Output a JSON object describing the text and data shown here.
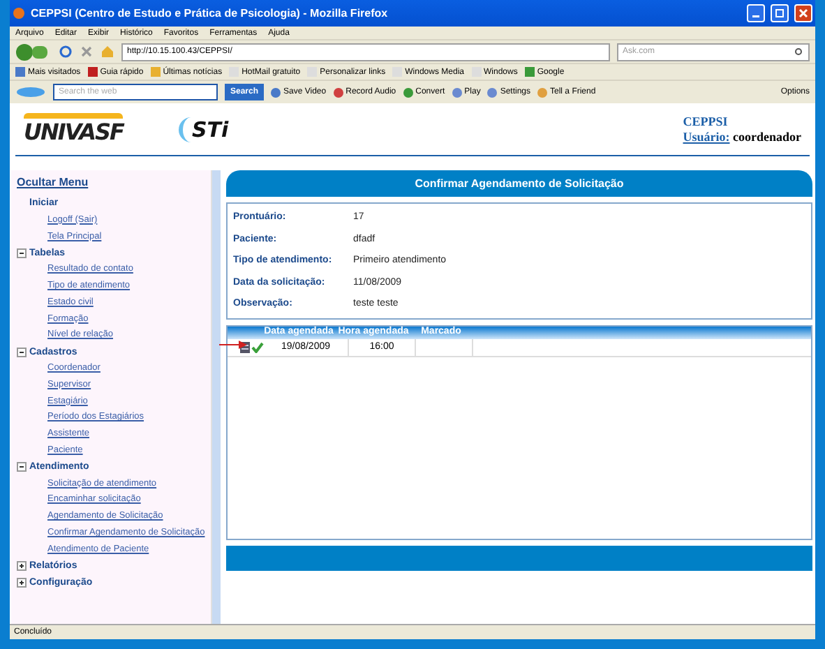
{
  "window": {
    "title": "CEPPSI (Centro de Estudo e Prática de Psicologia) - Mozilla Firefox"
  },
  "menu_bar": [
    "Arquivo",
    "Editar",
    "Exibir",
    "Histórico",
    "Favoritos",
    "Ferramentas",
    "Ajuda"
  ],
  "navigation": {
    "url": "http://10.15.100.43/CEPPSI/",
    "search_placeholder": "Ask.com"
  },
  "bookmarks": [
    "Mais visitados",
    "Guia rápido",
    "Últimas notícias",
    "HotMail gratuito",
    "Personalizar links",
    "Windows Media",
    "Windows",
    "Google"
  ],
  "ask_toolbar": {
    "search_placeholder": "Search the web",
    "search_button": "Search",
    "items": [
      "Save Video",
      "Record Audio",
      "Convert",
      "Play",
      "Settings",
      "Tell a Friend"
    ],
    "options": "Options"
  },
  "header": {
    "logos": [
      "UNIVASF",
      "STi"
    ],
    "system": "CEPPSI",
    "user_label": "Usuário:",
    "user": "coordenador"
  },
  "sidebar": {
    "toggle": "Ocultar Menu",
    "groups": [
      {
        "label": "Iniciar",
        "children": [
          "Logoff (Sair)",
          "Tela Principal"
        ]
      },
      {
        "label": "Tabelas",
        "expanded": true,
        "children": [
          "Resultado de contato",
          "Tipo de atendimento",
          "Estado civil",
          "Formação",
          "Nível de relação"
        ]
      },
      {
        "label": "Cadastros",
        "expanded": true,
        "children": [
          "Coordenador",
          "Supervisor",
          "Estagiário",
          "Período dos Estagiários",
          "Assistente",
          "Paciente"
        ]
      },
      {
        "label": "Atendimento",
        "expanded": true,
        "children": [
          "Solicitação de atendimento",
          "Encaminhar solicitação",
          "Agendamento de Solicitação",
          "Confirmar Agendamento de Solicitação",
          "Atendimento de Paciente"
        ]
      },
      {
        "label": "Relatórios",
        "expanded": false
      },
      {
        "label": "Configuração",
        "expanded": false
      }
    ]
  },
  "panel": {
    "title": "Confirmar Agendamento de Solicitação",
    "fields": [
      {
        "label": "Prontuário:",
        "value": "17"
      },
      {
        "label": "Paciente:",
        "value": "dfadf"
      },
      {
        "label": "Tipo de atendimento:",
        "value": "Primeiro atendimento"
      },
      {
        "label": "Data da solicitação:",
        "value": "11/08/2009"
      },
      {
        "label": "Observação:",
        "value": "teste teste"
      }
    ],
    "table": {
      "columns": [
        "Data agendada",
        "Hora agendada",
        "Marcado"
      ],
      "rows": [
        {
          "date": "19/08/2009",
          "time": "16:00",
          "confirmed": true,
          "pointed": true
        }
      ]
    }
  },
  "status_bar": "Concluído"
}
